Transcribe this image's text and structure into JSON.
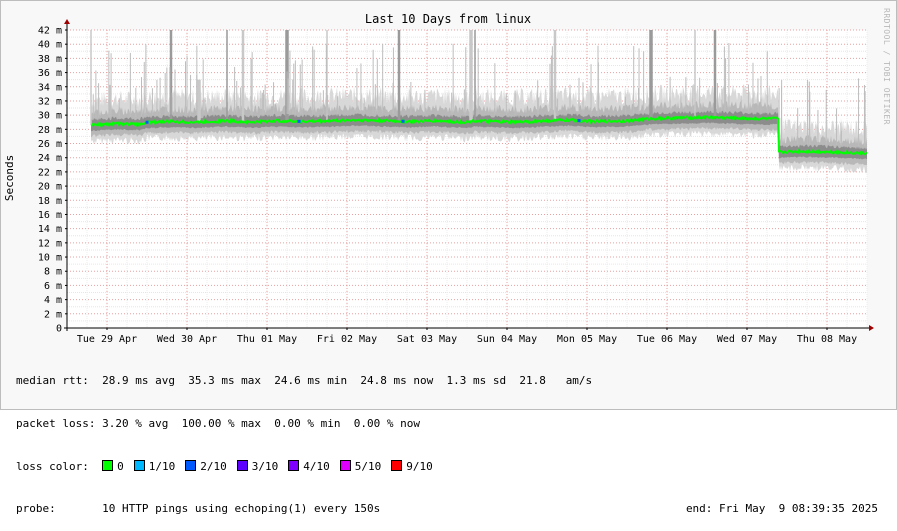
{
  "chart_data": {
    "type": "line",
    "title": "Last 10 Days from linux",
    "ylabel": "Seconds",
    "watermark": "RRDTOOL / TOBI OETIKER",
    "ylim": [
      0,
      42
    ],
    "y_ticks": [
      {
        "value": 0,
        "label": "0"
      },
      {
        "value": 2,
        "label": "2 m"
      },
      {
        "value": 4,
        "label": "4 m"
      },
      {
        "value": 6,
        "label": "6 m"
      },
      {
        "value": 8,
        "label": "8 m"
      },
      {
        "value": 10,
        "label": "10 m"
      },
      {
        "value": 12,
        "label": "12 m"
      },
      {
        "value": 14,
        "label": "14 m"
      },
      {
        "value": 16,
        "label": "16 m"
      },
      {
        "value": 18,
        "label": "18 m"
      },
      {
        "value": 20,
        "label": "20 m"
      },
      {
        "value": 22,
        "label": "22 m"
      },
      {
        "value": 24,
        "label": "24 m"
      },
      {
        "value": 26,
        "label": "26 m"
      },
      {
        "value": 28,
        "label": "28 m"
      },
      {
        "value": 30,
        "label": "30 m"
      },
      {
        "value": 32,
        "label": "32 m"
      },
      {
        "value": 34,
        "label": "34 m"
      },
      {
        "value": 36,
        "label": "36 m"
      },
      {
        "value": 38,
        "label": "38 m"
      },
      {
        "value": 40,
        "label": "40 m"
      },
      {
        "value": 42,
        "label": "42 m"
      }
    ],
    "x_ticks": [
      "Tue 29 Apr",
      "Wed 30 Apr",
      "Thu 01 May",
      "Fri 02 May",
      "Sat 03 May",
      "Sun 04 May",
      "Mon 05 May",
      "Tue 06 May",
      "Wed 07 May",
      "Thu 08 May"
    ],
    "series": [
      {
        "name": "median rtt",
        "color": "#00ff00",
        "x_day": [
          0.3,
          0.6,
          0.9,
          1.0,
          1.3,
          1.6,
          2.0,
          2.3,
          2.6,
          3.0,
          3.3,
          3.6,
          4.0,
          4.3,
          4.6,
          5.0,
          5.1,
          5.3,
          5.6,
          6.0,
          6.3,
          6.6,
          7.0,
          7.3,
          7.6,
          8.0,
          8.3,
          8.6,
          8.9,
          9.2,
          9.6,
          10.0
        ],
        "values": [
          28.6,
          28.8,
          28.7,
          29.0,
          29.1,
          29.0,
          29.2,
          29.0,
          29.2,
          29.1,
          29.2,
          29.3,
          29.2,
          29.1,
          29.2,
          29.0,
          29.2,
          29.1,
          29.0,
          29.2,
          29.3,
          29.1,
          29.2,
          29.5,
          29.6,
          29.7,
          29.6,
          29.5,
          24.8,
          24.9,
          24.8,
          24.6
        ]
      },
      {
        "name": "spikes",
        "color": "#666666",
        "x_day": [
          0.3,
          1.3,
          1.65,
          2.0,
          2.2,
          2.75,
          3.25,
          4.15,
          5.05,
          5.1,
          6.1,
          7.3,
          7.85,
          8.1
        ],
        "values": [
          42,
          42,
          35,
          42,
          42,
          42,
          42,
          42,
          42,
          42,
          42,
          42,
          42,
          42
        ]
      }
    ]
  },
  "legend": {
    "median_label": "median rtt:",
    "median_values": "28.9 ms avg  35.3 ms max  24.6 ms min  24.8 ms now  1.3 ms sd  21.8   am/s",
    "loss_label": "packet loss:",
    "loss_values": "3.20 % avg  100.00 % max  0.00 % min  0.00 % now",
    "color_label": "loss color:",
    "loss_colors": [
      {
        "label": "0",
        "color": "#00ff00"
      },
      {
        "label": "1/10",
        "color": "#00b8ff"
      },
      {
        "label": "2/10",
        "color": "#0059ff"
      },
      {
        "label": "3/10",
        "color": "#5e00ff"
      },
      {
        "label": "4/10",
        "color": "#7e00ff"
      },
      {
        "label": "5/10",
        "color": "#dd00ff"
      },
      {
        "label": "9/10",
        "color": "#ff0000"
      }
    ],
    "probe_label": "probe:",
    "probe_text": "10 HTTP pings using echoping(1) every 150s",
    "end_text": "end: Fri May  9 08:39:35 2025"
  }
}
